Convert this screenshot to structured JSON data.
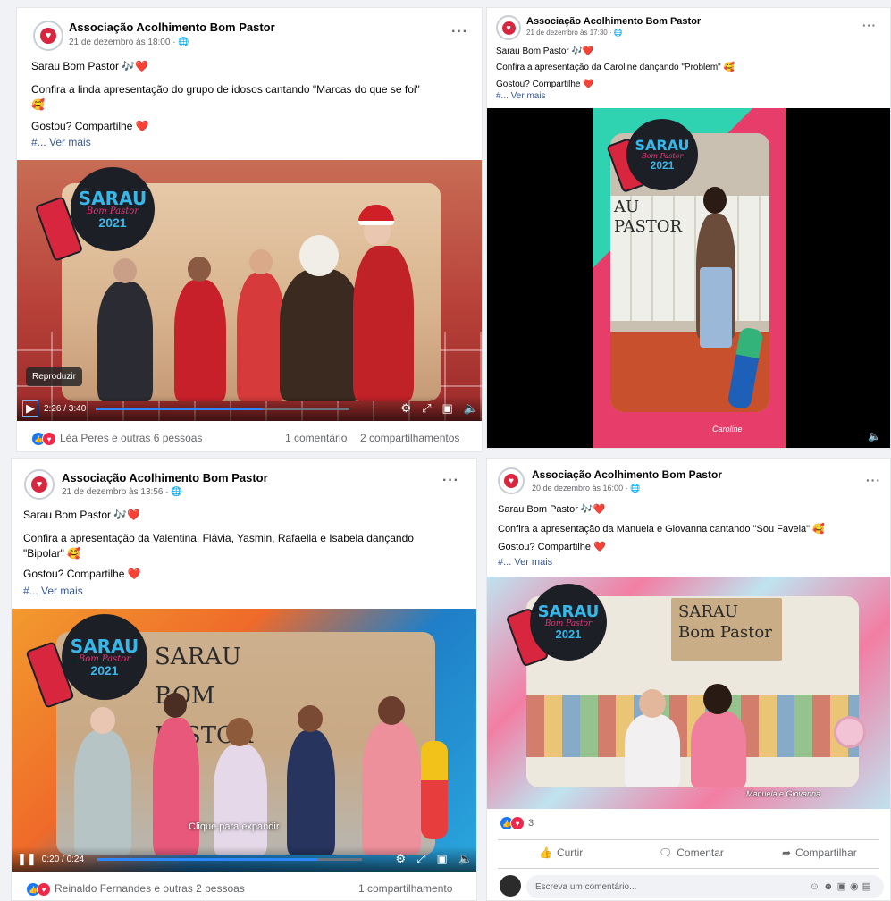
{
  "page_name": "Associação Acolhimento Bom Pastor",
  "posts": [
    {
      "time": "21 de dezembro às 18:00 · ",
      "title": "Sarau Bom Pastor 🎶❤️",
      "body": "Confira a linda apresentação do grupo de idosos cantando \"Marcas do que se foi\"",
      "body2": "🥰",
      "cta": "Gostou? Compartilhe ❤️",
      "more": "#... Ver mais",
      "logo": {
        "l1": "SARAU",
        "l2": "Bom Pastor",
        "l3": "2021"
      },
      "tooltip": "Reproduzir",
      "video_time": "2:26 / 3:40",
      "progress": 0.66,
      "reactions": "Léa Peres e outras 6 pessoas",
      "comments": "1 comentário",
      "shares": "2 compartilhamentos"
    },
    {
      "time": "21 de dezembro às 17:30 · ",
      "title": "Sarau Bom Pastor 🎶❤️",
      "body": "Confira a apresentação da Caroline dançando \"Problem\" 🥰",
      "cta": "Gostou? Compartilhe ❤️",
      "more": "#... Ver mais",
      "logo": {
        "l1": "SARAU",
        "l2": "Bom Pastor",
        "l3": "2021"
      },
      "caption": "Caroline",
      "wall_text": "AU PASTOR"
    },
    {
      "time": "21 de dezembro às 13:56 · ",
      "title": "Sarau Bom Pastor 🎶❤️",
      "body": "Confira a apresentação da Valentina, Flávia, Yasmin, Rafaella e Isabela dançando",
      "body2": "\"Bipolar\" 🥰",
      "cta": "Gostou? Compartilhe ❤️",
      "more": "#... Ver mais",
      "logo": {
        "l1": "SARAU",
        "l2": "Bom Pastor",
        "l3": "2021"
      },
      "wall_text": "SARAU BOM PASTOR",
      "expand_hint": "Clique para expandir",
      "video_time": "0:20 / 0:24",
      "progress": 0.83,
      "reactions": "Reinaldo Fernandes e outras 2 pessoas",
      "shares": "1 compartilhamento"
    },
    {
      "time": "20 de dezembro às 16:00 · ",
      "title": "Sarau Bom Pastor 🎶❤️",
      "body": "Confira a apresentação da Manuela e Giovanna cantando \"Sou Favela\" 🥰",
      "cta": "Gostou? Compartilhe ❤️",
      "more": "#... Ver mais",
      "logo": {
        "l1": "SARAU",
        "l2": "Bom Pastor",
        "l3": "2021"
      },
      "wall_text": "SARAU Bom Pastor",
      "caption": "Manuela e Giovanna",
      "reaction_count": "3",
      "like_label": "Curtir",
      "comment_label": "Comentar",
      "share_label": "Compartilhar",
      "comment_placeholder": "Escreva um comentário..."
    }
  ],
  "colors": {
    "accent": "#1877f2",
    "love": "#f0284a",
    "brand_red": "#d7263d",
    "sarau_blue": "#38b6e8"
  }
}
